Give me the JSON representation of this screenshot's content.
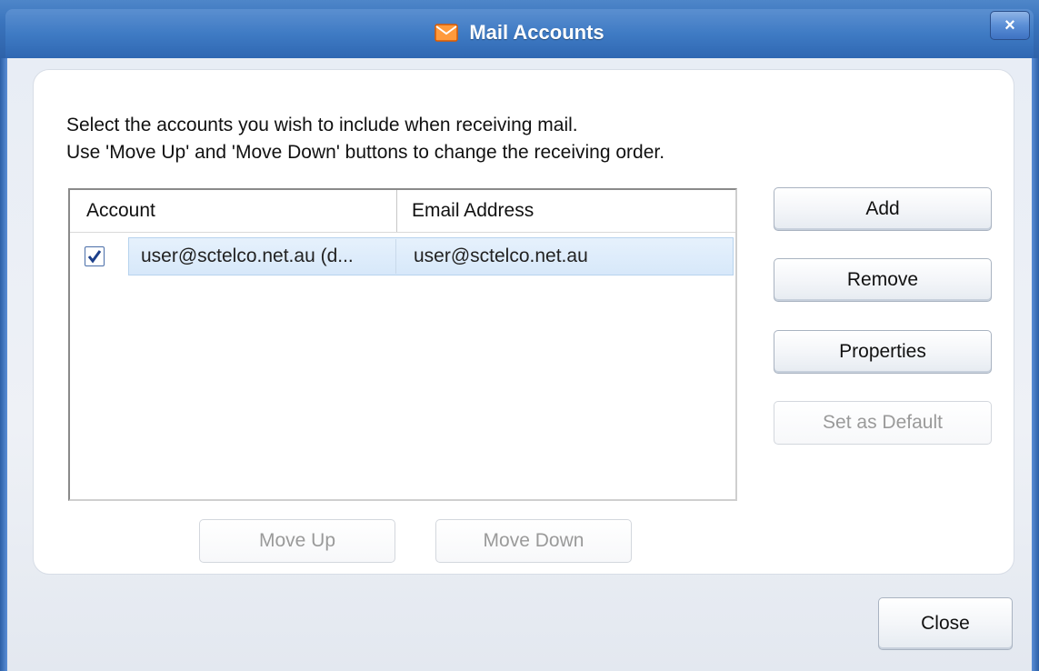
{
  "window": {
    "title": "Mail Accounts",
    "close_glyph": "×"
  },
  "instructions": {
    "line1": "Select the accounts you wish to include when receiving mail.",
    "line2": "Use 'Move Up' and 'Move Down' buttons to change the receiving order."
  },
  "accounts_list": {
    "columns": [
      "Account",
      "Email Address"
    ],
    "rows": [
      {
        "checked": true,
        "account": "user@sctelco.net.au (d...",
        "email": "user@sctelco.net.au"
      }
    ]
  },
  "buttons": {
    "add": "Add",
    "remove": "Remove",
    "properties": "Properties",
    "set_default": "Set as Default",
    "move_up": "Move Up",
    "move_down": "Move Down",
    "close": "Close"
  },
  "colors": {
    "titlebar": "#3f7bc4",
    "selection": "#d7e8fa"
  }
}
